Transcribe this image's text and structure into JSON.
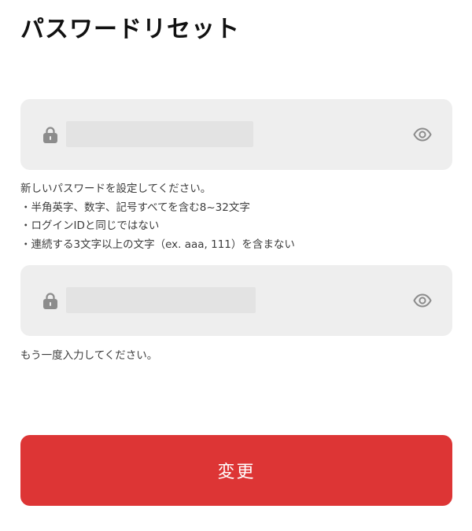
{
  "page": {
    "title": "パスワードリセット"
  },
  "password_field": {
    "value": "",
    "lock_icon": "lock-icon",
    "toggle_icon": "eye-icon"
  },
  "password_hint": {
    "lines": [
      "新しいパスワードを設定してください。",
      "・半角英字、数字、記号すべてを含む8~32文字",
      "・ログインIDと同じではない",
      "・連続する3文字以上の文字（ex. aaa, 111）を含まない"
    ]
  },
  "confirm_field": {
    "value": "",
    "lock_icon": "lock-icon",
    "toggle_icon": "eye-icon"
  },
  "confirm_hint": {
    "text": "もう一度入力してください。"
  },
  "submit": {
    "label": "変更"
  },
  "colors": {
    "accent": "#dd3535",
    "field_background": "#eeeeee",
    "icon": "#8c8c8c"
  }
}
